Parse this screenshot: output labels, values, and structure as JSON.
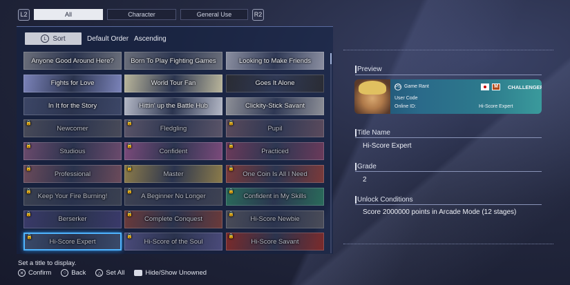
{
  "tabs": {
    "left_trigger": "L2",
    "right_trigger": "R2",
    "items": [
      {
        "label": "All",
        "active": true
      },
      {
        "label": "Character",
        "active": false
      },
      {
        "label": "General Use",
        "active": false
      }
    ]
  },
  "sort": {
    "button_label": "Sort",
    "order_label": "Default Order",
    "direction_label": "Ascending"
  },
  "titles": [
    {
      "label": "Anyone Good Around Here?",
      "locked": false,
      "bg": "#6a6e7a"
    },
    {
      "label": "Born To Play Fighting Games",
      "locked": false,
      "bg": "#6a6e7a"
    },
    {
      "label": "Looking to Make Friends",
      "locked": false,
      "bg": "#8a8ea0"
    },
    {
      "label": "Fights for Love",
      "locked": false,
      "bg": "#7a82b8"
    },
    {
      "label": "World Tour Fan",
      "locked": false,
      "bg": "#b8b49a"
    },
    {
      "label": "Goes It Alone",
      "locked": false,
      "bg": "#2a2c34"
    },
    {
      "label": "In It for the Story",
      "locked": false,
      "bg": "#3c4666"
    },
    {
      "label": "Hittin' up the Battle Hub",
      "locked": false,
      "bg": "#b2b6c4"
    },
    {
      "label": "Clickity-Stick Savant",
      "locked": false,
      "bg": "#8c8e96"
    },
    {
      "label": "Newcomer",
      "locked": true,
      "bg": "#484a58"
    },
    {
      "label": "Fledgling",
      "locked": true,
      "bg": "#5a5468"
    },
    {
      "label": "Pupil",
      "locked": true,
      "bg": "#5a4a5c"
    },
    {
      "label": "Studious",
      "locked": true,
      "bg": "#6a4a6c"
    },
    {
      "label": "Confident",
      "locked": true,
      "bg": "#7a4a7a"
    },
    {
      "label": "Practiced",
      "locked": true,
      "bg": "#6a3a5a"
    },
    {
      "label": "Professional",
      "locked": true,
      "bg": "#6a4a5a"
    },
    {
      "label": "Master",
      "locked": true,
      "bg": "#8a7a4a"
    },
    {
      "label": "One Coin Is All I Need",
      "locked": true,
      "bg": "#7a3a3a"
    },
    {
      "label": "Keep Your Fire Burning!",
      "locked": true,
      "bg": "#3a4050"
    },
    {
      "label": "A Beginner No Longer",
      "locked": true,
      "bg": "#3e4252"
    },
    {
      "label": "Confident in My Skills",
      "locked": true,
      "bg": "#2a6a5a"
    },
    {
      "label": "Berserker",
      "locked": true,
      "bg": "#3a3a6a"
    },
    {
      "label": "Complete Conquest",
      "locked": true,
      "bg": "#6a3a3a"
    },
    {
      "label": "Hi-Score Newbie",
      "locked": true,
      "bg": "#4a4c58"
    },
    {
      "label": "Hi-Score Expert",
      "locked": true,
      "bg": "#3a4a6a",
      "selected": true
    },
    {
      "label": "Hi-Score of the Soul",
      "locked": true,
      "bg": "#4a4a7a"
    },
    {
      "label": "Hi-Score Savant",
      "locked": true,
      "bg": "#7a2a2a"
    }
  ],
  "preview": {
    "label": "Preview",
    "platform": "PS",
    "name": "Game Rant",
    "user_code_label": "User Code",
    "online_id_label": "Online ID:",
    "title_text": "Hi-Score Expert",
    "flag_letter": "M",
    "badge_top": "CHALLENGER"
  },
  "title_name": {
    "label": "Title Name",
    "value": "Hi-Score Expert"
  },
  "grade": {
    "label": "Grade",
    "value": "2"
  },
  "unlock": {
    "label": "Unlock Conditions",
    "value": "Score 2000000 points in Arcade Mode (12 stages)"
  },
  "footer": {
    "hint": "Set a title to display.",
    "confirm": "Confirm",
    "back": "Back",
    "set_all": "Set All",
    "hide_show": "Hide/Show Unowned"
  },
  "colors": {
    "selection": "#4fb4ff",
    "panel": "#14224a"
  }
}
